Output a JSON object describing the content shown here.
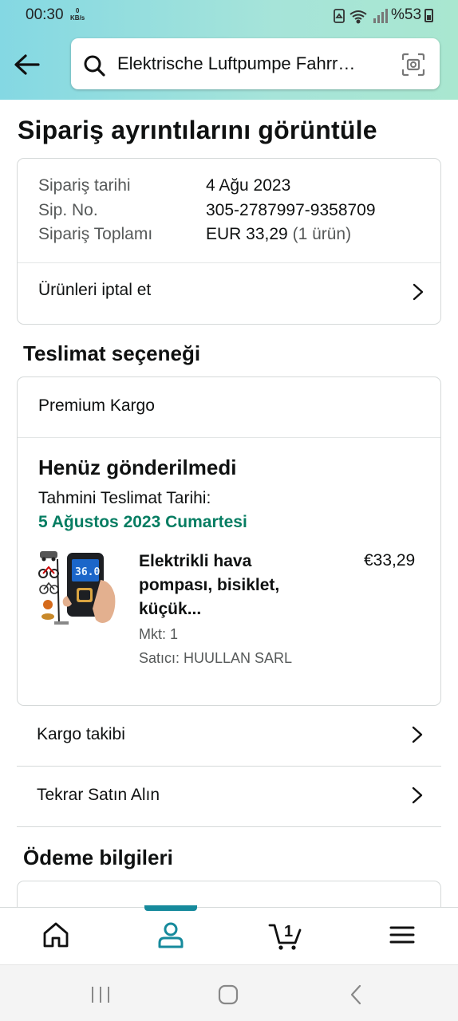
{
  "status_bar": {
    "time": "00:30",
    "net_speed_value": "0",
    "net_speed_unit": "KB/s",
    "battery": "%53"
  },
  "search": {
    "query": "Elektrische Luftpumpe Fahrr…"
  },
  "page": {
    "title": "Sipariş ayrıntılarını görüntüle"
  },
  "order_summary": {
    "date_label": "Sipariş tarihi",
    "date_value": "4 Ağu 2023",
    "number_label": "Sip. No.",
    "number_value": "305-2787997-9358709",
    "total_label": "Sipariş Toplamı",
    "total_value": "EUR 33,29",
    "total_items": "(1 ürün)",
    "cancel_label": "Ürünleri iptal et"
  },
  "delivery": {
    "section_title": "Teslimat seçeneği",
    "method": "Premium Kargo",
    "status": "Henüz gönderilmedi",
    "estimate_label": "Tahmini Teslimat Tarihi:",
    "estimate_date": "5 Ağustos 2023 Cumartesi",
    "estimate_color": "#067d62"
  },
  "product": {
    "title_line1": "Elektrikli hava",
    "title_line2": "pompası, bisiklet,",
    "title_line3": "küçük...",
    "price": "€33,29",
    "quantity": "Mkt: 1",
    "seller": "Satıcı: HUULLAN SARL",
    "screen_reading": "36.0"
  },
  "actions": {
    "track": "Kargo takibi",
    "buy_again": "Tekrar Satın Alın"
  },
  "payment": {
    "section_title": "Ödeme bilgileri"
  },
  "bottom_nav": {
    "items": [
      "home-icon",
      "account-icon",
      "cart-icon",
      "menu-icon"
    ],
    "cart_count": "1",
    "accent_color": "#168a9c"
  },
  "system_nav": {
    "items": [
      "recents-icon",
      "home-button-icon",
      "back-nav-icon"
    ]
  }
}
